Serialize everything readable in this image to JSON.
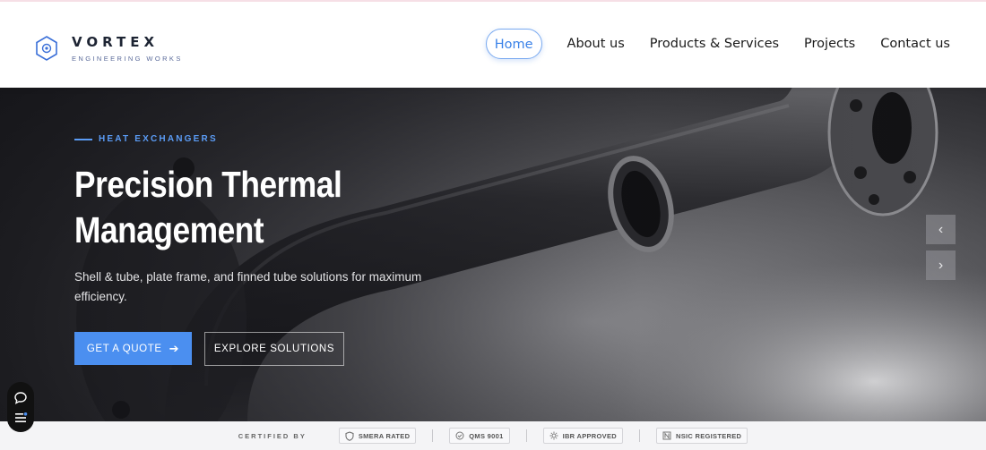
{
  "brand": {
    "name": "VORTEX",
    "tagline": "ENGINEERING WORKS",
    "accent": "#4b8ff0"
  },
  "nav": {
    "items": [
      {
        "label": "Home",
        "active": true
      },
      {
        "label": "About us",
        "active": false
      },
      {
        "label": "Products & Services",
        "active": false
      },
      {
        "label": "Projects",
        "active": false
      },
      {
        "label": "Contact us",
        "active": false
      }
    ]
  },
  "hero": {
    "eyebrow": "HEAT EXCHANGERS",
    "title_line1": "Precision Thermal",
    "title_line2": "Management",
    "description": "Shell & tube, plate frame, and finned tube solutions for maximum efficiency.",
    "primary_button": "GET A QUOTE",
    "primary_icon": "arrow-right-icon",
    "secondary_button": "EXPLORE SOLUTIONS",
    "prev_glyph": "‹",
    "next_glyph": "›"
  },
  "chat_widget": {
    "icons": [
      "chat-bubble-icon",
      "menu-icon"
    ]
  },
  "certifications": {
    "label": "CERTIFIED BY",
    "badges": [
      {
        "label": "SMERA RATED",
        "icon": "shield-icon"
      },
      {
        "label": "QMS 9001",
        "icon": "check-circle-icon"
      },
      {
        "label": "IBR APPROVED",
        "icon": "sun-icon"
      },
      {
        "label": "NSIC REGISTERED",
        "icon": "n-badge-icon"
      }
    ]
  }
}
